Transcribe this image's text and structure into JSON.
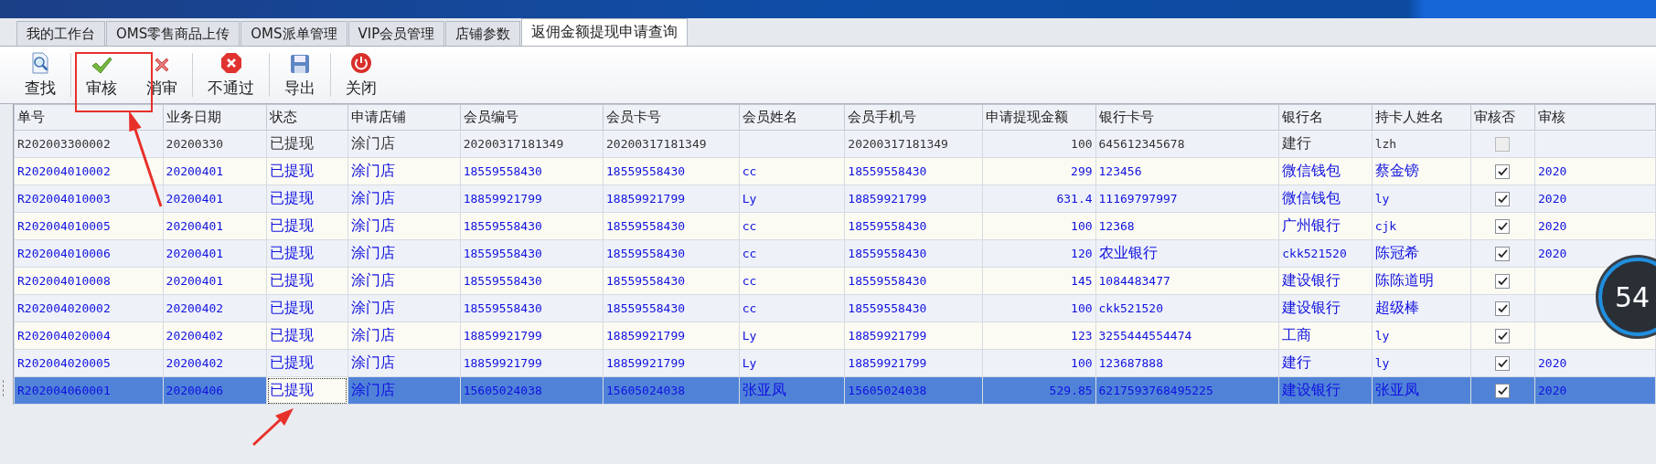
{
  "tabs": [
    {
      "label": "我的工作台",
      "selected": false
    },
    {
      "label": "OMS零售商品上传",
      "selected": false
    },
    {
      "label": "OMS派单管理",
      "selected": false
    },
    {
      "label": "VIP会员管理",
      "selected": false
    },
    {
      "label": "店铺参数",
      "selected": false
    },
    {
      "label": "返佣金额提现申请查询",
      "selected": true
    }
  ],
  "toolbar": [
    {
      "kind": "search",
      "label": "查找",
      "group_end": true
    },
    {
      "kind": "approve",
      "label": "审核",
      "group_end": false
    },
    {
      "kind": "unapprove",
      "label": "消审",
      "group_end": true
    },
    {
      "kind": "reject",
      "label": "不通过",
      "group_end": true
    },
    {
      "kind": "export",
      "label": "导出",
      "group_end": true
    },
    {
      "kind": "close",
      "label": "关闭",
      "group_end": false
    }
  ],
  "table": {
    "columns": [
      "单号",
      "业务日期",
      "状态",
      "申请店铺",
      "会员编号",
      "会员卡号",
      "会员姓名",
      "会员手机号",
      "申请提现金额",
      "银行卡号",
      "银行名",
      "持卡人姓名",
      "审核否",
      "审核"
    ],
    "rows": [
      {
        "cells": [
          "R202003300002",
          "20200330",
          "已提现",
          "涂门店",
          "20200317181349",
          "20200317181349",
          "",
          "20200317181349",
          "100",
          "645612345678",
          "建行",
          "lzh"
        ],
        "approved": false,
        "column_14": "",
        "selected": false,
        "status_focused": false
      },
      {
        "cells": [
          "R202004010002",
          "20200401",
          "已提现",
          "涂门店",
          "18559558430",
          "18559558430",
          "cc",
          "18559558430",
          "299",
          "123456",
          "微信钱包",
          "蔡金镑"
        ],
        "approved": true,
        "column_14": "2020",
        "selected": false,
        "status_focused": false
      },
      {
        "cells": [
          "R202004010003",
          "20200401",
          "已提现",
          "涂门店",
          "18859921799",
          "18859921799",
          "Ly",
          "18859921799",
          "631.4",
          "11169797997",
          "微信钱包",
          "ly"
        ],
        "approved": true,
        "column_14": "2020",
        "selected": false,
        "status_focused": false
      },
      {
        "cells": [
          "R202004010005",
          "20200401",
          "已提现",
          "涂门店",
          "18559558430",
          "18559558430",
          "cc",
          "18559558430",
          "100",
          "12368",
          "广州银行",
          "cjk"
        ],
        "approved": true,
        "column_14": "2020",
        "selected": false,
        "status_focused": false
      },
      {
        "cells": [
          "R202004010006",
          "20200401",
          "已提现",
          "涂门店",
          "18559558430",
          "18559558430",
          "cc",
          "18559558430",
          "120",
          "农业银行",
          "ckk521520",
          "陈冠希"
        ],
        "approved": true,
        "column_14": "2020",
        "selected": false,
        "status_focused": false
      },
      {
        "cells": [
          "R202004010008",
          "20200401",
          "已提现",
          "涂门店",
          "18559558430",
          "18559558430",
          "cc",
          "18559558430",
          "145",
          "1084483477",
          "建设银行",
          "陈陈道明"
        ],
        "approved": true,
        "column_14": "",
        "selected": false,
        "status_focused": false
      },
      {
        "cells": [
          "R202004020002",
          "20200402",
          "已提现",
          "涂门店",
          "18559558430",
          "18559558430",
          "cc",
          "18559558430",
          "100",
          "ckk521520",
          "建设银行",
          "超级棒"
        ],
        "approved": true,
        "column_14": "",
        "selected": false,
        "status_focused": false
      },
      {
        "cells": [
          "R202004020004",
          "20200402",
          "已提现",
          "涂门店",
          "18859921799",
          "18859921799",
          "Ly",
          "18859921799",
          "123",
          "3255444554474",
          "工商",
          "ly"
        ],
        "approved": true,
        "column_14": "",
        "selected": false,
        "status_focused": false
      },
      {
        "cells": [
          "R202004020005",
          "20200402",
          "已提现",
          "涂门店",
          "18859921799",
          "18859921799",
          "Ly",
          "18859921799",
          "100",
          "123687888",
          "建行",
          "ly"
        ],
        "approved": true,
        "column_14": "2020",
        "selected": false,
        "status_focused": false
      },
      {
        "cells": [
          "R202004060001",
          "20200406",
          "已提现",
          "涂门店",
          "15605024038",
          "15605024038",
          "张亚凤",
          "15605024038",
          "529.85",
          "6217593768495225",
          "建设银行",
          "张亚凤"
        ],
        "approved": true,
        "column_14": "2020",
        "selected": true,
        "status_focused": true
      }
    ]
  },
  "overlay_badge": {
    "text": "54"
  }
}
